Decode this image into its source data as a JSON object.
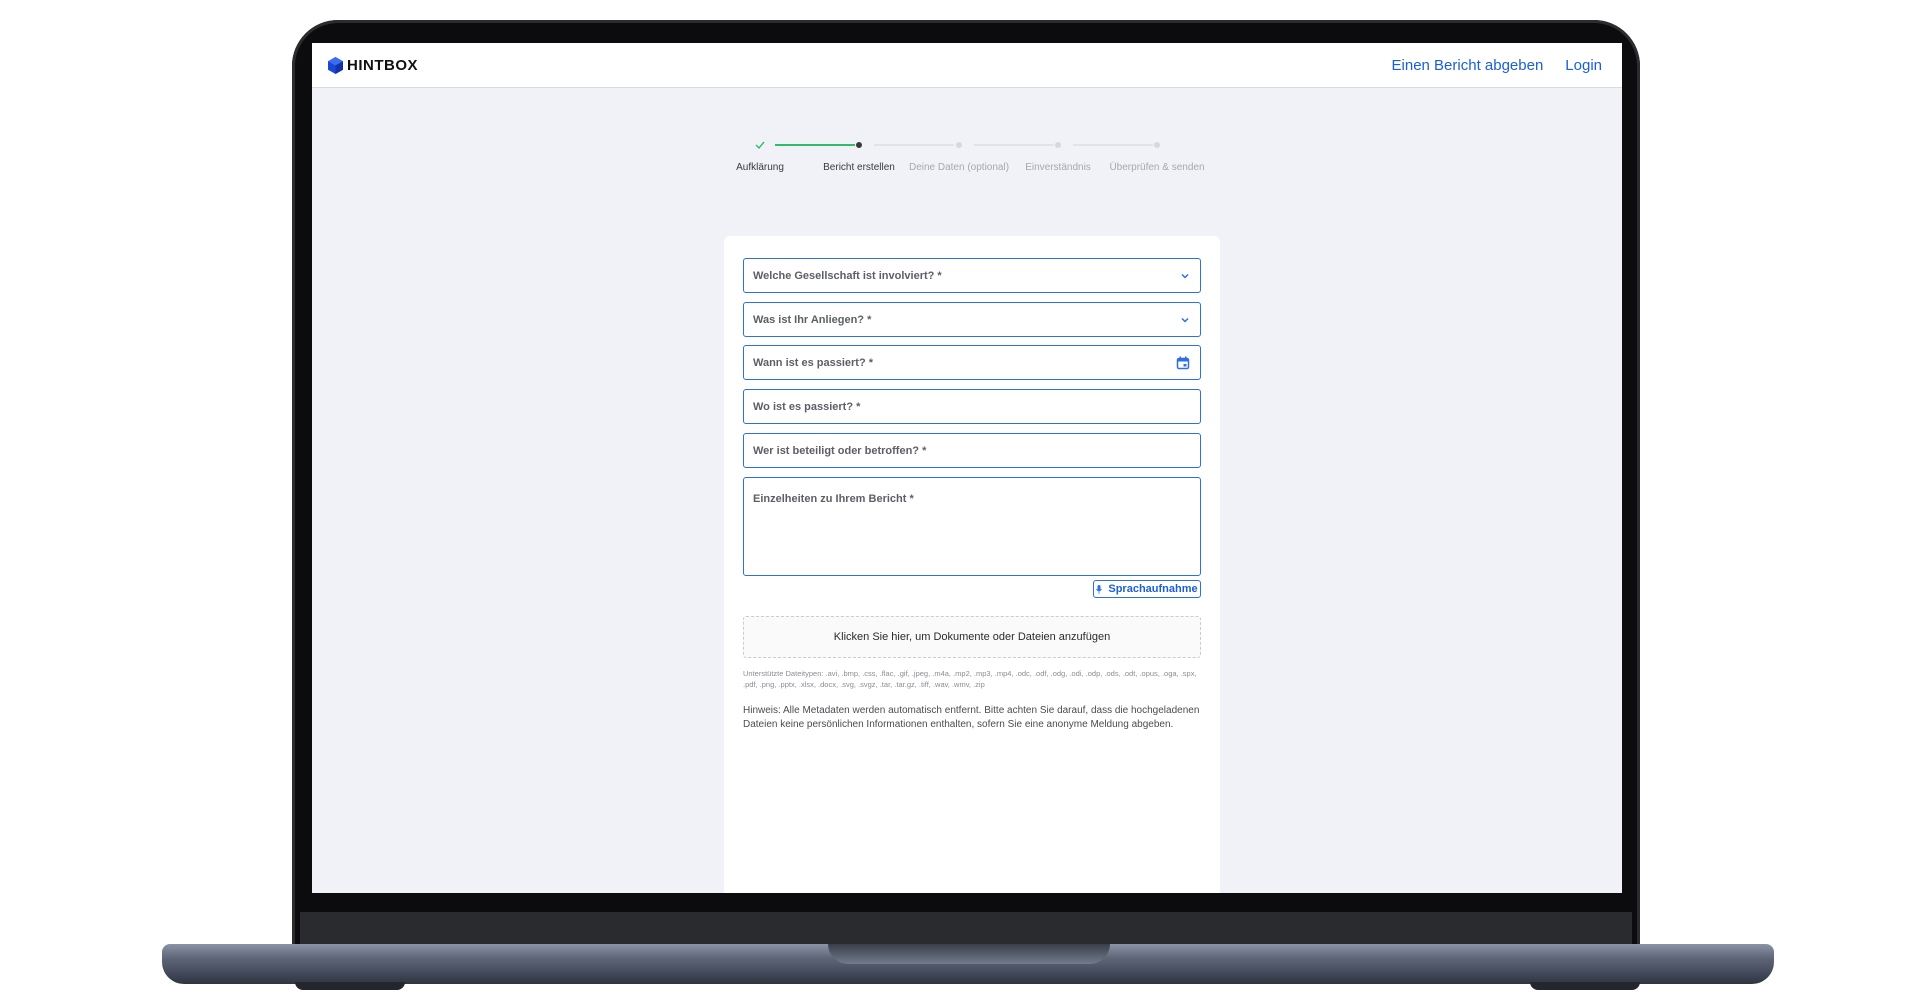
{
  "header": {
    "brand": "HINTBOX",
    "nav": {
      "report": "Einen Bericht abgeben",
      "login": "Login"
    }
  },
  "stepper": {
    "steps": [
      {
        "label": "Aufklärung",
        "state": "done"
      },
      {
        "label": "Bericht erstellen",
        "state": "current"
      },
      {
        "label": "Deine Daten (optional)",
        "state": "upcoming"
      },
      {
        "label": "Einverständnis",
        "state": "upcoming"
      },
      {
        "label": "Überprüfen & senden",
        "state": "upcoming"
      }
    ]
  },
  "form": {
    "company": "Welche Gesellschaft ist involviert? *",
    "concern": "Was ist Ihr Anliegen? *",
    "when": "Wann ist es passiert? *",
    "where": "Wo ist es passiert? *",
    "who": "Wer ist beteiligt oder betroffen? *",
    "details": "Einzelheiten zu Ihrem Bericht *",
    "voice_button": "Sprachaufnahme",
    "dropzone": "Klicken Sie hier, um Dokumente oder Dateien anzufügen",
    "filetypes": "Unterstützte Dateitypen: .avi, .bmp, .css, .flac, .gif, .jpeg, .m4a, .mp2, .mp3, .mp4, .odc, .odf, .odg, .odi, .odp, .ods, .odt, .opus, .oga, .spx, .pdf, .png, .pptx, .xlsx, .docx, .svg, .svgz, .tar, .tar.gz, .tiff, .wav, .wmv, .zip",
    "hint": "Hinweis: Alle Metadaten werden automatisch entfernt. Bitte achten Sie darauf, dass die hochgeladenen Dateien keine persönlichen Informationen enthalten, sofern Sie eine anonyme Meldung abgeben."
  },
  "colors": {
    "accent": "#2f6fe4",
    "link": "#1a5fd6",
    "success": "#2fbd68",
    "background": "#f1f2f7"
  }
}
